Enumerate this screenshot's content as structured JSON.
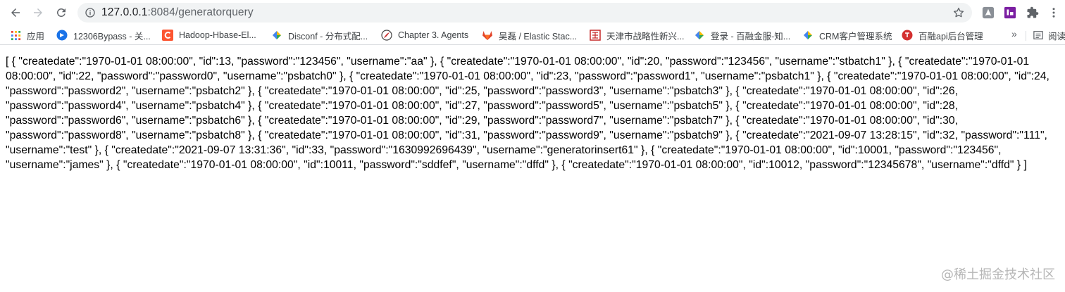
{
  "browser": {
    "url_host": "127.0.0.1",
    "url_path": ":8084/generatorquery",
    "icons": {
      "back": "arrow-left-icon",
      "forward": "arrow-right-icon",
      "reload": "reload-icon",
      "info": "info-icon",
      "star": "star-icon",
      "extensions": [
        "acrobat-extension-icon",
        "json-viewer-extension-icon",
        "puzzle-extensions-icon",
        "kebab-menu-icon"
      ]
    }
  },
  "bookmarks": {
    "items": [
      {
        "label": "应用",
        "icon": "apps-grid-icon"
      },
      {
        "label": "12306Bypass - 关...",
        "icon": "globe-blue-icon"
      },
      {
        "label": "Hadoop-Hbase-El...",
        "icon": "csdn-c-icon"
      },
      {
        "label": "Disconf - 分布式配...",
        "icon": "diamond-icon"
      },
      {
        "label": "Chapter 3. Agents",
        "icon": "feather-icon"
      },
      {
        "label": "吴磊 / Elastic Stac...",
        "icon": "gitlab-fox-icon"
      },
      {
        "label": "天津市战略性新兴...",
        "icon": "seal-icon"
      },
      {
        "label": "登录 - 百融金服-知...",
        "icon": "diamond-icon"
      },
      {
        "label": "CRM客户管理系统",
        "icon": "diamond-icon"
      },
      {
        "label": "百融api后台管理",
        "icon": "red-circle-icon"
      }
    ],
    "more": "»",
    "reading_list": "阅读"
  },
  "page": {
    "json_text": "[ { \"createdate\":\"1970-01-01 08:00:00\", \"id\":13, \"password\":\"123456\", \"username\":\"aa\" }, { \"createdate\":\"1970-01-01 08:00:00\", \"id\":20, \"password\":\"123456\", \"username\":\"stbatch1\" }, { \"createdate\":\"1970-01-01 08:00:00\", \"id\":22, \"password\":\"password0\", \"username\":\"psbatch0\" }, { \"createdate\":\"1970-01-01 08:00:00\", \"id\":23, \"password\":\"password1\", \"username\":\"psbatch1\" }, { \"createdate\":\"1970-01-01 08:00:00\", \"id\":24, \"password\":\"password2\", \"username\":\"psbatch2\" }, { \"createdate\":\"1970-01-01 08:00:00\", \"id\":25, \"password\":\"password3\", \"username\":\"psbatch3\" }, { \"createdate\":\"1970-01-01 08:00:00\", \"id\":26, \"password\":\"password4\", \"username\":\"psbatch4\" }, { \"createdate\":\"1970-01-01 08:00:00\", \"id\":27, \"password\":\"password5\", \"username\":\"psbatch5\" }, { \"createdate\":\"1970-01-01 08:00:00\", \"id\":28, \"password\":\"password6\", \"username\":\"psbatch6\" }, { \"createdate\":\"1970-01-01 08:00:00\", \"id\":29, \"password\":\"password7\", \"username\":\"psbatch7\" }, { \"createdate\":\"1970-01-01 08:00:00\", \"id\":30, \"password\":\"password8\", \"username\":\"psbatch8\" }, { \"createdate\":\"1970-01-01 08:00:00\", \"id\":31, \"password\":\"password9\", \"username\":\"psbatch9\" }, { \"createdate\":\"2021-09-07 13:28:15\", \"id\":32, \"password\":\"111\", \"username\":\"test\" }, { \"createdate\":\"2021-09-07 13:31:36\", \"id\":33, \"password\":\"1630992696439\", \"username\":\"generatorinsert61\" }, { \"createdate\":\"1970-01-01 08:00:00\", \"id\":10001, \"password\":\"123456\", \"username\":\"james\" }, { \"createdate\":\"1970-01-01 08:00:00\", \"id\":10011, \"password\":\"sddfef\", \"username\":\"dffd\" }, { \"createdate\":\"1970-01-01 08:00:00\", \"id\":10012, \"password\":\"12345678\", \"username\":\"dffd\" } ]"
  },
  "watermark": "@稀土掘金技术社区",
  "colors": {
    "omnibox_bg": "#f1f3f4",
    "toolbar_icon": "#5f6368",
    "text": "#000000"
  }
}
